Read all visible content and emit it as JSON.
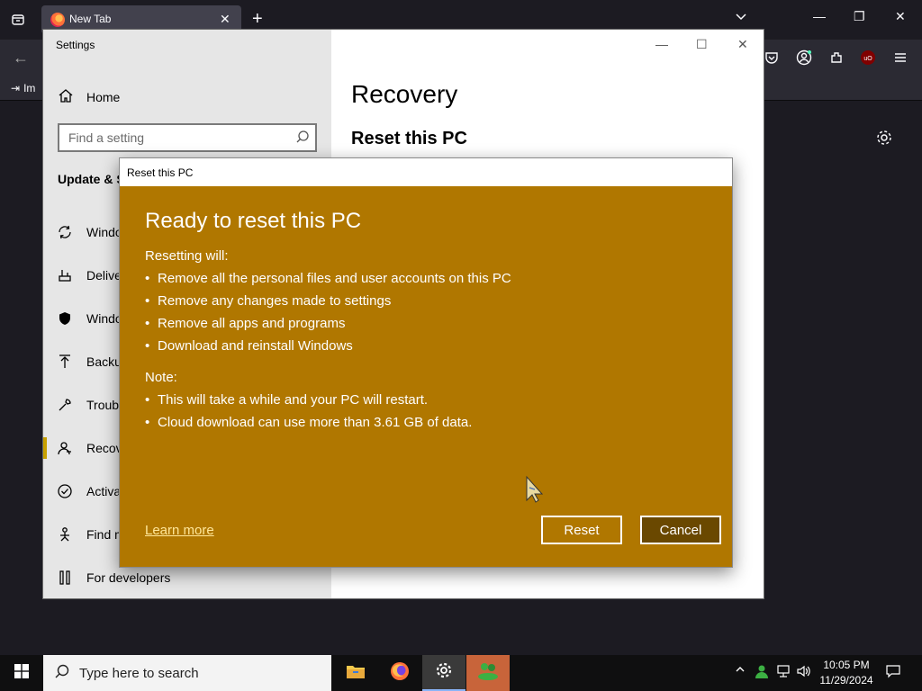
{
  "browser": {
    "tab_title": "New Tab",
    "bookmark_import_label": "Im"
  },
  "settings": {
    "window_title": "Settings",
    "home_label": "Home",
    "search_placeholder": "Find a setting",
    "section_title": "Update & S",
    "nav_items": [
      {
        "label": "Windo",
        "icon": "refresh-icon"
      },
      {
        "label": "Delive",
        "icon": "delivery-icon"
      },
      {
        "label": "Windo",
        "icon": "shield-icon"
      },
      {
        "label": "Backu",
        "icon": "backup-icon"
      },
      {
        "label": "Troub",
        "icon": "wrench-icon"
      },
      {
        "label": "Recov",
        "icon": "recovery-icon",
        "active": true
      },
      {
        "label": "Activa",
        "icon": "check-circle-icon"
      },
      {
        "label": "Find m",
        "icon": "person-icon"
      },
      {
        "label": "For developers",
        "icon": "developer-icon"
      }
    ],
    "main_title": "Recovery",
    "main_subtitle": "Reset this PC"
  },
  "dialog": {
    "window_title": "Reset this PC",
    "heading": "Ready to reset this PC",
    "resetting_label": "Resetting will:",
    "resetting_items": [
      "Remove all the personal files and user accounts on this PC",
      "Remove any changes made to settings",
      "Remove all apps and programs",
      "Download and reinstall Windows"
    ],
    "note_label": "Note:",
    "note_items": [
      "This will take a while and your PC will restart.",
      "Cloud download can use more than 3.61 GB of data."
    ],
    "learn_more": "Learn more",
    "reset_button": "Reset",
    "cancel_button": "Cancel",
    "background_color": "#b07700"
  },
  "taskbar": {
    "search_placeholder": "Type here to search",
    "time": "10:05 PM",
    "date": "11/29/2024"
  }
}
